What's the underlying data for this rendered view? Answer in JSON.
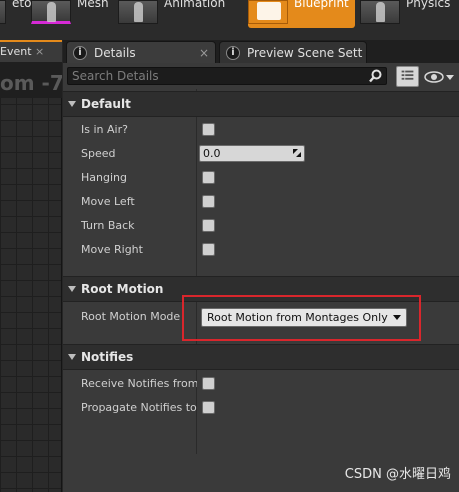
{
  "toolbar": {
    "modes": [
      {
        "label": "eton"
      },
      {
        "label": "Mesh"
      },
      {
        "label": "Animation"
      },
      {
        "label": "Blueprint"
      },
      {
        "label": "Physics"
      }
    ]
  },
  "viewport": {
    "tab_label": "Event ",
    "header_text": "om -7"
  },
  "tabs": [
    {
      "label": "Details",
      "icon": "info-icon",
      "active": true
    },
    {
      "label": "Preview Scene Sett",
      "icon": "info-icon",
      "active": false
    }
  ],
  "details": {
    "search_placeholder": "Search Details",
    "sections": {
      "default": {
        "title": "Default",
        "properties": [
          {
            "label": "Is in Air?",
            "type": "checkbox",
            "checked": false
          },
          {
            "label": "Speed",
            "type": "number",
            "value": "0.0"
          },
          {
            "label": "Hanging",
            "type": "checkbox",
            "checked": false
          },
          {
            "label": "Move Left",
            "type": "checkbox",
            "checked": false
          },
          {
            "label": "Turn Back",
            "type": "checkbox",
            "checked": false
          },
          {
            "label": "Move Right",
            "type": "checkbox",
            "checked": false
          }
        ]
      },
      "root_motion": {
        "title": "Root Motion",
        "properties": [
          {
            "label": "Root Motion Mode",
            "type": "enum",
            "value": "Root Motion from Montages Only"
          }
        ]
      },
      "notifies": {
        "title": "Notifies",
        "properties": [
          {
            "label": "Receive Notifies from I",
            "type": "checkbox",
            "checked": false
          },
          {
            "label": "Propagate Notifies to L",
            "type": "checkbox",
            "checked": false
          }
        ]
      }
    }
  },
  "watermark": "CSDN @水曜日鸡",
  "colors": {
    "accent": "#e48a1b",
    "highlight": "#d9262c"
  }
}
